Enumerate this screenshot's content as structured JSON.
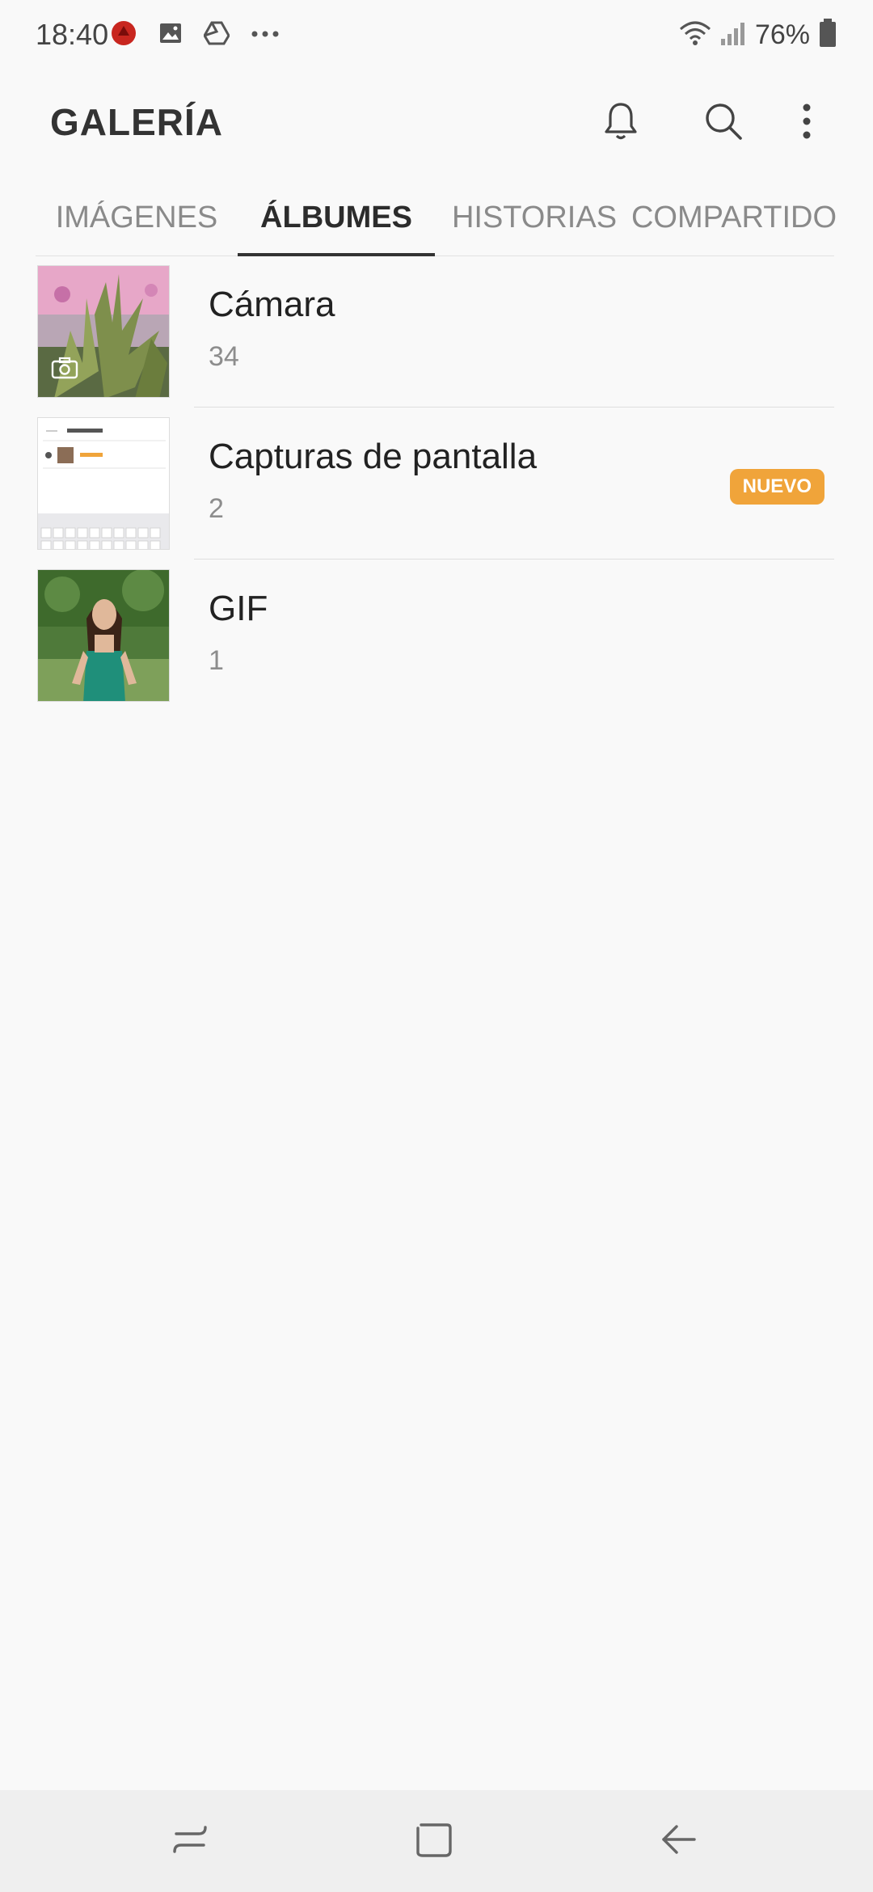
{
  "status_bar": {
    "time": "18:40",
    "battery_text": "76%",
    "icons_left": [
      "notification-app-icon",
      "image-icon",
      "drive-icon",
      "more-dots-icon"
    ],
    "icons_right": [
      "wifi-icon",
      "signal-icon",
      "battery-icon"
    ]
  },
  "header": {
    "title": "GALERÍA",
    "actions": [
      "bell-icon",
      "search-icon",
      "more-vert-icon"
    ]
  },
  "tabs": [
    {
      "label": "IMÁGENES",
      "active": false
    },
    {
      "label": "ÁLBUMES",
      "active": true
    },
    {
      "label": "HISTORIAS",
      "active": false
    },
    {
      "label": "COMPARTIDO",
      "active": false
    }
  ],
  "albums": [
    {
      "name": "Cámara",
      "count": "34",
      "badge": ""
    },
    {
      "name": "Capturas de pantalla",
      "count": "2",
      "badge": "NUEVO"
    },
    {
      "name": "GIF",
      "count": "1",
      "badge": ""
    }
  ],
  "nav": [
    "recents-icon",
    "home-icon",
    "back-icon"
  ],
  "colors": {
    "background": "#f9f9f9",
    "accent_badge": "#f0a43a",
    "tab_active": "#2c2c2c",
    "tab_inactive": "#8a8a8a",
    "navbar": "#efefef"
  }
}
